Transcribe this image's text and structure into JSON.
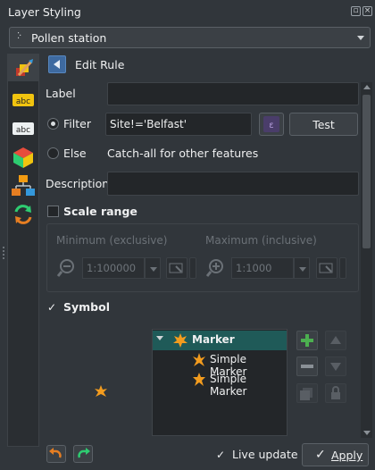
{
  "window": {
    "title": "Layer Styling",
    "float_icon": "float-icon",
    "close_icon": "close-icon"
  },
  "layer_selector": {
    "value": "Pollen station"
  },
  "sidebar": {
    "items": [
      "symbology-icon",
      "labels-icon",
      "masks-icon",
      "3d-view-icon",
      "diagrams-icon",
      "history-icon"
    ]
  },
  "header": {
    "title": "Edit Rule"
  },
  "form": {
    "label": {
      "label": "Label",
      "value": ""
    },
    "filter": {
      "label": "Filter",
      "value": "Site!='Belfast'",
      "test_button": "Test",
      "selected": true
    },
    "else": {
      "label": "Else",
      "description": "Catch-all for other features",
      "selected": false
    },
    "description": {
      "label": "Description",
      "value": ""
    }
  },
  "scale_range": {
    "label": "Scale range",
    "checked": false,
    "min_label": "Minimum (exclusive)",
    "min_value": "1:100000",
    "max_label": "Maximum (inclusive)",
    "max_value": "1:1000"
  },
  "symbol": {
    "label": "Symbol",
    "checked": true,
    "tree": [
      {
        "label": "Marker",
        "level": 0,
        "expanded": true,
        "selected": true
      },
      {
        "label": "Simple Marker",
        "level": 1
      },
      {
        "label": "Simple Marker",
        "level": 1
      }
    ]
  },
  "footer": {
    "live_update_label": "Live update",
    "live_update_checked": true,
    "apply_label": "Apply"
  },
  "colors": {
    "accent": "#3e6aa0",
    "selection": "#1f5a58",
    "marker_orange": "#f39c1e",
    "add_green": "#4caf50"
  }
}
